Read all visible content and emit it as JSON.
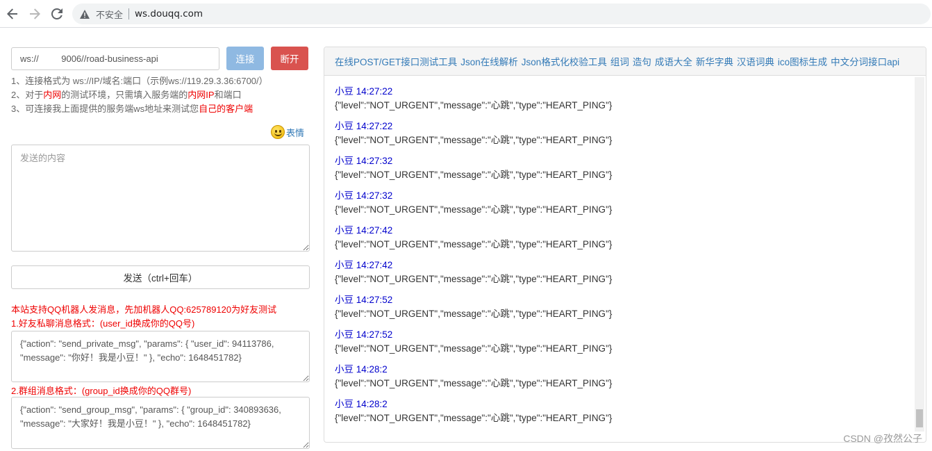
{
  "browser": {
    "insecure_label": "不安全",
    "url": "ws.douqq.com"
  },
  "connect": {
    "ws_value": "ws://         9006//road-business-api",
    "connect_label": "连接",
    "disconnect_label": "断开"
  },
  "tips": {
    "line1": "1、连接格式为 ws://IP/域名:端口（示例ws://119.29.3.36:6700/）",
    "line2_a": "2、对于",
    "line2_b": "内网",
    "line2_c": "的测试环境，只需填入服务端的",
    "line2_d": "内网IP",
    "line2_e": "和端口",
    "line3_a": "3、可连接我上面提供的服务端ws地址来测试您",
    "line3_b": "自己的客户端"
  },
  "emoji_label": "表情",
  "send": {
    "placeholder": "发送的内容",
    "button_label": "发送（ctrl+回车）"
  },
  "qq": {
    "notice": "本站支持QQ机器人发消息，先加机器人QQ:625789120为好友测试",
    "private_title": "1.好友私聊消息格式：(user_id换成你的QQ号)",
    "private_code": "{\"action\": \"send_private_msg\", \"params\": { \"user_id\": 94113786, \"message\": \"你好！我是小豆！\" }, \"echo\": 1648451782}",
    "group_title": "2.群组消息格式：(group_id换成你的QQ群号)",
    "group_code": "{\"action\": \"send_group_msg\", \"params\": { \"group_id\": 340893636, \"message\": \"大家好！我是小豆！\" }, \"echo\": 1648451782}"
  },
  "tools_links": [
    "在线POST/GET接口测试工具",
    "Json在线解析",
    "Json格式化校验工具",
    "组词",
    "造句",
    "成语大全",
    "新华字典",
    "汉语词典",
    "ico图标生成",
    "中文分词接口api"
  ],
  "messages": [
    {
      "head": "小豆 14:27:22",
      "body": "{\"level\":\"NOT_URGENT\",\"message\":\"心跳\",\"type\":\"HEART_PING\"}"
    },
    {
      "head": "小豆 14:27:22",
      "body": "{\"level\":\"NOT_URGENT\",\"message\":\"心跳\",\"type\":\"HEART_PING\"}"
    },
    {
      "head": "小豆 14:27:32",
      "body": "{\"level\":\"NOT_URGENT\",\"message\":\"心跳\",\"type\":\"HEART_PING\"}"
    },
    {
      "head": "小豆 14:27:32",
      "body": "{\"level\":\"NOT_URGENT\",\"message\":\"心跳\",\"type\":\"HEART_PING\"}"
    },
    {
      "head": "小豆 14:27:42",
      "body": "{\"level\":\"NOT_URGENT\",\"message\":\"心跳\",\"type\":\"HEART_PING\"}"
    },
    {
      "head": "小豆 14:27:42",
      "body": "{\"level\":\"NOT_URGENT\",\"message\":\"心跳\",\"type\":\"HEART_PING\"}"
    },
    {
      "head": "小豆 14:27:52",
      "body": "{\"level\":\"NOT_URGENT\",\"message\":\"心跳\",\"type\":\"HEART_PING\"}"
    },
    {
      "head": "小豆 14:27:52",
      "body": "{\"level\":\"NOT_URGENT\",\"message\":\"心跳\",\"type\":\"HEART_PING\"}"
    },
    {
      "head": "小豆 14:28:2",
      "body": "{\"level\":\"NOT_URGENT\",\"message\":\"心跳\",\"type\":\"HEART_PING\"}"
    },
    {
      "head": "小豆 14:28:2",
      "body": "{\"level\":\"NOT_URGENT\",\"message\":\"心跳\",\"type\":\"HEART_PING\"}"
    }
  ],
  "watermark": "CSDN @孜然公子",
  "colors": {
    "link": "#337ab7",
    "danger": "#d9534f",
    "primary_light": "#8fb9e2",
    "red_text": "#ee0000",
    "msg_head": "#0000cc"
  },
  "icons": {
    "back": "arrow-left-icon",
    "forward": "arrow-right-icon",
    "reload": "reload-icon",
    "security": "warning-triangle-icon",
    "emoji": "smiley-icon"
  }
}
